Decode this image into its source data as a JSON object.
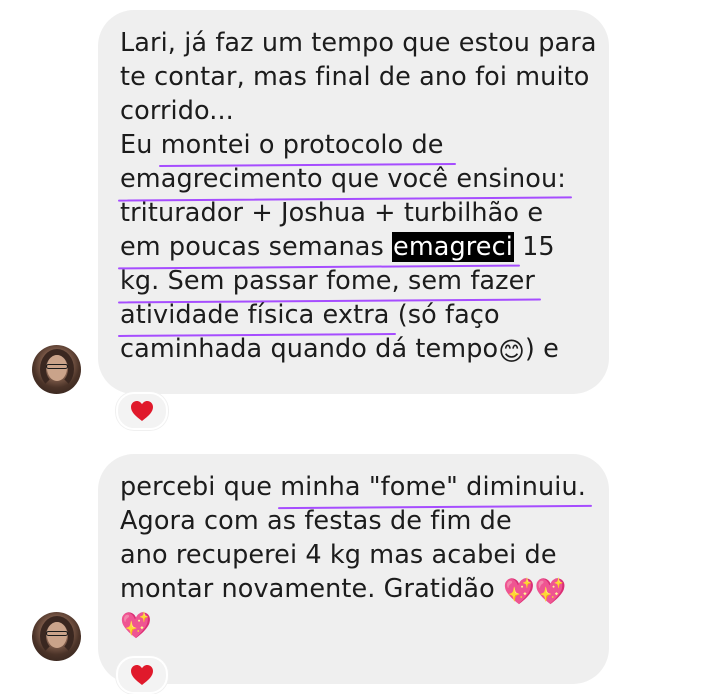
{
  "messages": [
    {
      "lines": [
        "Lari, já faz um tempo que estou para",
        "te contar, mas final de ano foi muito",
        "corrido..."
      ],
      "l4_a": "Eu ",
      "l4_u": "montei o protocolo de",
      "l5_u": "emagrecimento que você ensinou:",
      "l6": "triturador + Joshua + turbilhão e",
      "l7_u": "em poucas semanas ",
      "l7_hl": "emagreci",
      "l7_b": " 15",
      "l8_u": "kg. Sem passar fome, sem fazer",
      "l9_u": "atividade física extra",
      "l9_b": " (só faço",
      "l10_a": "caminhada quando dá tempo",
      "l10_emoji": "😊",
      "l10_b": ") e",
      "reaction": "heart"
    },
    {
      "l1_a": "percebi que ",
      "l1_u": "minha \"fome\" diminuiu.",
      "lines": [
        "Agora com as festas de fim de",
        "ano recuperei 4 kg mas acabei de"
      ],
      "l4_a": "montar novamente. Gratidão ",
      "l4_emoji": "💖💖",
      "l5_emoji": "💖",
      "reaction": "heart"
    }
  ],
  "colors": {
    "bubble": "#efefef",
    "underline": "#a64dff",
    "highlight": "#000000",
    "heart": "#e0192b"
  }
}
